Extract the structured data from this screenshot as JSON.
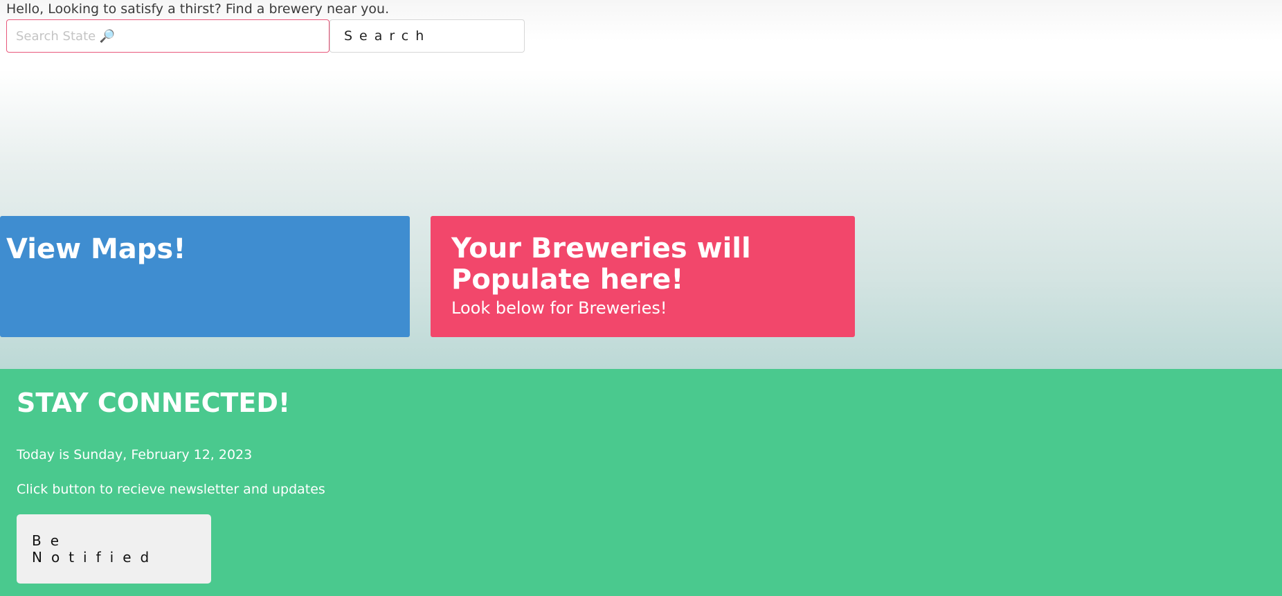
{
  "header": {
    "greeting": "Hello, Looking to satisfy a thirst? Find a brewery near you."
  },
  "search": {
    "placeholder": "Search State 🔎",
    "value": "",
    "button_label": "Search"
  },
  "cards": {
    "maps": {
      "title": "View Maps!",
      "color": "#3f8dd0"
    },
    "breweries": {
      "title": "Your Breweries will Populate here!",
      "subtitle": "Look below for Breweries!",
      "color": "#f2476b"
    }
  },
  "footer": {
    "heading": "STAY CONNECTED!",
    "date_text": "Today is Sunday, February 12, 2023",
    "cta_text": "Click button to recieve newsletter and updates",
    "notify_button_label": "Be Notified",
    "color": "#4ac98e"
  }
}
